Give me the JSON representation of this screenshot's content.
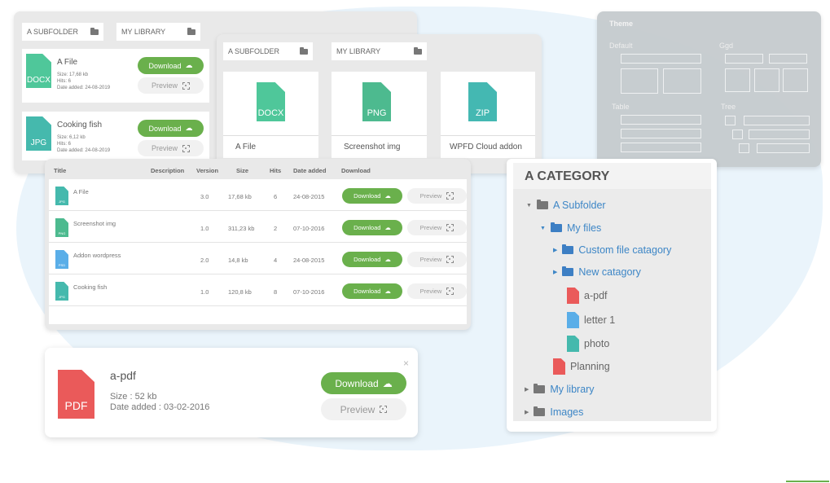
{
  "colors": {
    "download": "#6ab04c",
    "docx": "#4fc79a",
    "png": "#4dba8f",
    "zip": "#44b8b2",
    "jpg": "#45b9ad",
    "psd": "#5aaee8",
    "pdf": "#ea5a5a",
    "link": "#3d86c6"
  },
  "list_view": {
    "tabs": [
      {
        "label": "A SUBFOLDER",
        "icon": "folder-icon"
      },
      {
        "label": "MY LIBRARY",
        "icon": "folder-icon"
      }
    ],
    "files": [
      {
        "title": "A File",
        "type": "DOCX",
        "size": "Size: 17,68 kb",
        "hits": "Hits: 6",
        "date": "Date added: 24-08-2019",
        "download": "Download",
        "preview": "Preview"
      },
      {
        "title": "Cooking fish",
        "type": "JPG",
        "size": "Size: 6,12 kb",
        "hits": "Hits: 6",
        "date": "Date added: 24-08-2019",
        "download": "Download",
        "preview": "Preview"
      }
    ]
  },
  "grid_view": {
    "tabs": [
      {
        "label": "A SUBFOLDER",
        "icon": "folder-icon"
      },
      {
        "label": "MY LIBRARY",
        "icon": "folder-icon"
      }
    ],
    "files": [
      {
        "title": "A File",
        "type": "DOCX"
      },
      {
        "title": "Screenshot img",
        "type": "PNG"
      },
      {
        "title": "WPFD Cloud addon",
        "type": "ZIP"
      }
    ]
  },
  "theme_panel": {
    "title": "Theme",
    "options": [
      "Default",
      "Ggd",
      "Table",
      "Tree"
    ]
  },
  "table_view": {
    "headers": [
      "Title",
      "Description",
      "Version",
      "Size",
      "Hits",
      "Date added",
      "Download"
    ],
    "rows": [
      {
        "type": "JPG",
        "title": "A File",
        "version": "3.0",
        "size": "17,68 kb",
        "hits": "6",
        "date": "24-08-2015",
        "download": "Download",
        "preview": "Preview"
      },
      {
        "type": "PNG",
        "title": "Screenshot img",
        "version": "1.0",
        "size": "311,23 kb",
        "hits": "2",
        "date": "07-10-2016",
        "download": "Download",
        "preview": "Preview"
      },
      {
        "type": "PSD",
        "title": "Addon wordpress",
        "version": "2.0",
        "size": "14,8 kb",
        "hits": "4",
        "date": "24-08-2015",
        "download": "Download",
        "preview": "Preview"
      },
      {
        "type": "JPG",
        "title": "Cooking fish",
        "version": "1.0",
        "size": "120,8 kb",
        "hits": "8",
        "date": "07-10-2016",
        "download": "Download",
        "preview": "Preview"
      }
    ]
  },
  "category_tree": {
    "title": "A CATEGORY",
    "items": [
      "A Subfolder",
      "My files",
      "Custom file catagory",
      "New catagory",
      "a-pdf",
      "letter 1",
      "photo",
      "Planning",
      "My library",
      "Images"
    ]
  },
  "file_card": {
    "title": "a-pdf",
    "type": "PDF",
    "size": "Size : 52 kb",
    "date": "Date added : 03-02-2016",
    "download": "Download",
    "preview": "Preview",
    "close": "×"
  }
}
